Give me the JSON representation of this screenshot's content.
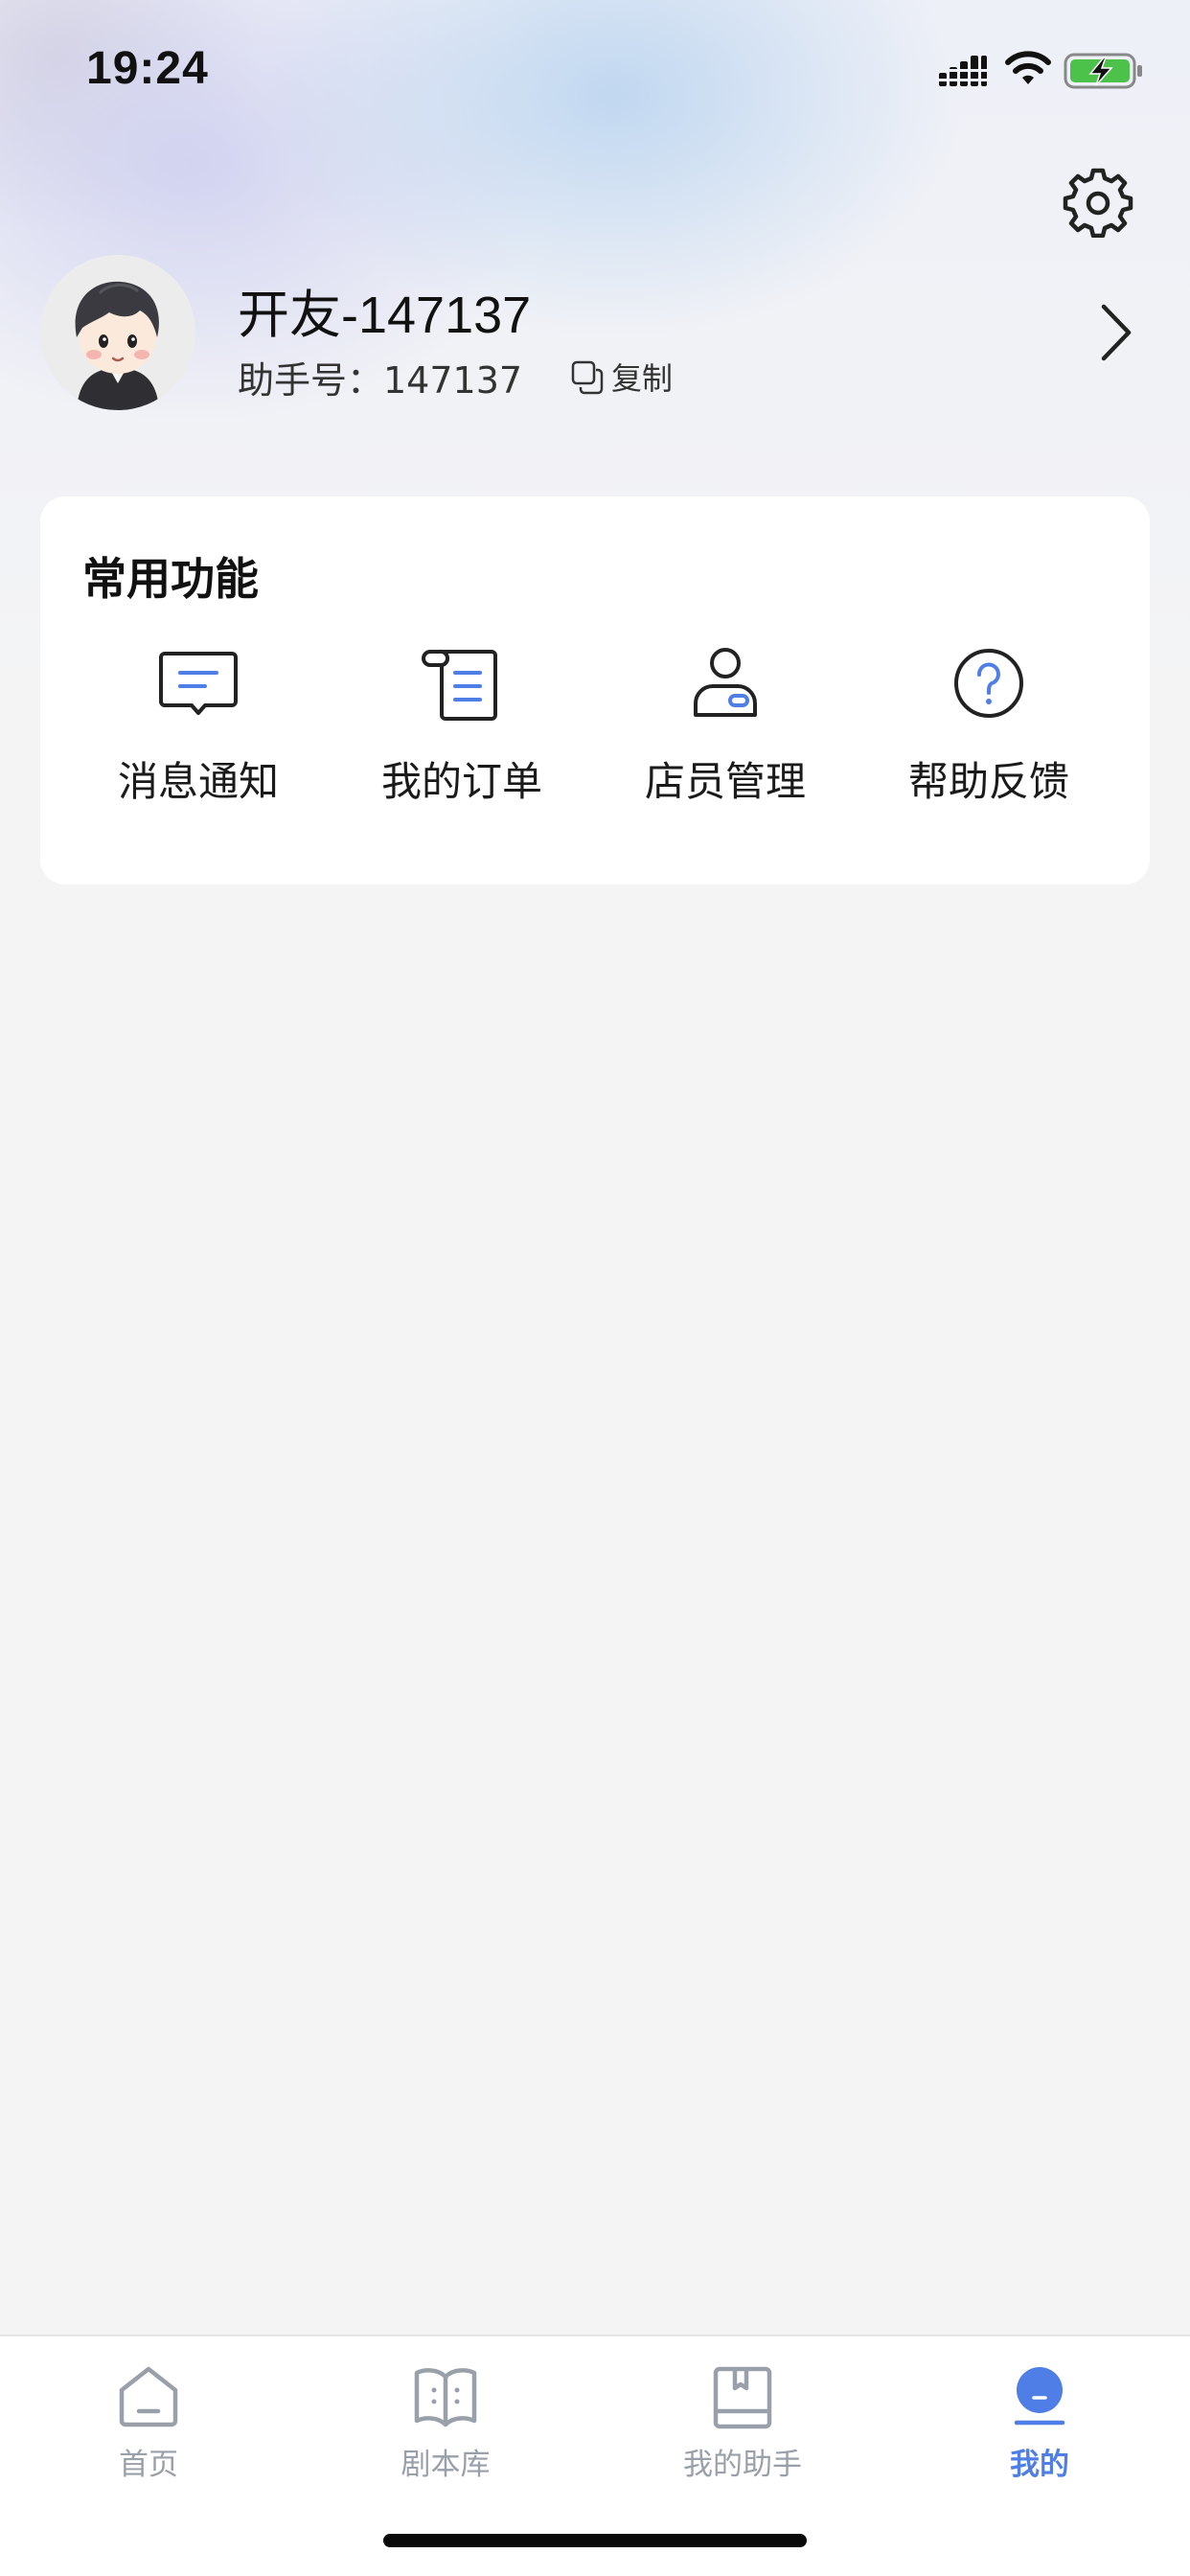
{
  "status_bar": {
    "time": "19:24"
  },
  "profile": {
    "name": "开友-147137",
    "assistant_id_label": "助手号：147137",
    "copy_label": "复制"
  },
  "common_functions": {
    "title": "常用功能",
    "items": [
      {
        "label": "消息通知",
        "icon": "message-icon"
      },
      {
        "label": "我的订单",
        "icon": "order-icon"
      },
      {
        "label": "店员管理",
        "icon": "staff-icon"
      },
      {
        "label": "帮助反馈",
        "icon": "help-icon"
      }
    ]
  },
  "tab_bar": {
    "tabs": [
      {
        "label": "首页",
        "icon": "home-icon",
        "active": false
      },
      {
        "label": "剧本库",
        "icon": "script-library-icon",
        "active": false
      },
      {
        "label": "我的助手",
        "icon": "assistant-icon",
        "active": false
      },
      {
        "label": "我的",
        "icon": "profile-icon",
        "active": true
      }
    ]
  },
  "colors": {
    "accent": "#4f7ee6",
    "tab_inactive": "#9aa0aa",
    "background": "#f4f4f5",
    "card": "#ffffff"
  }
}
